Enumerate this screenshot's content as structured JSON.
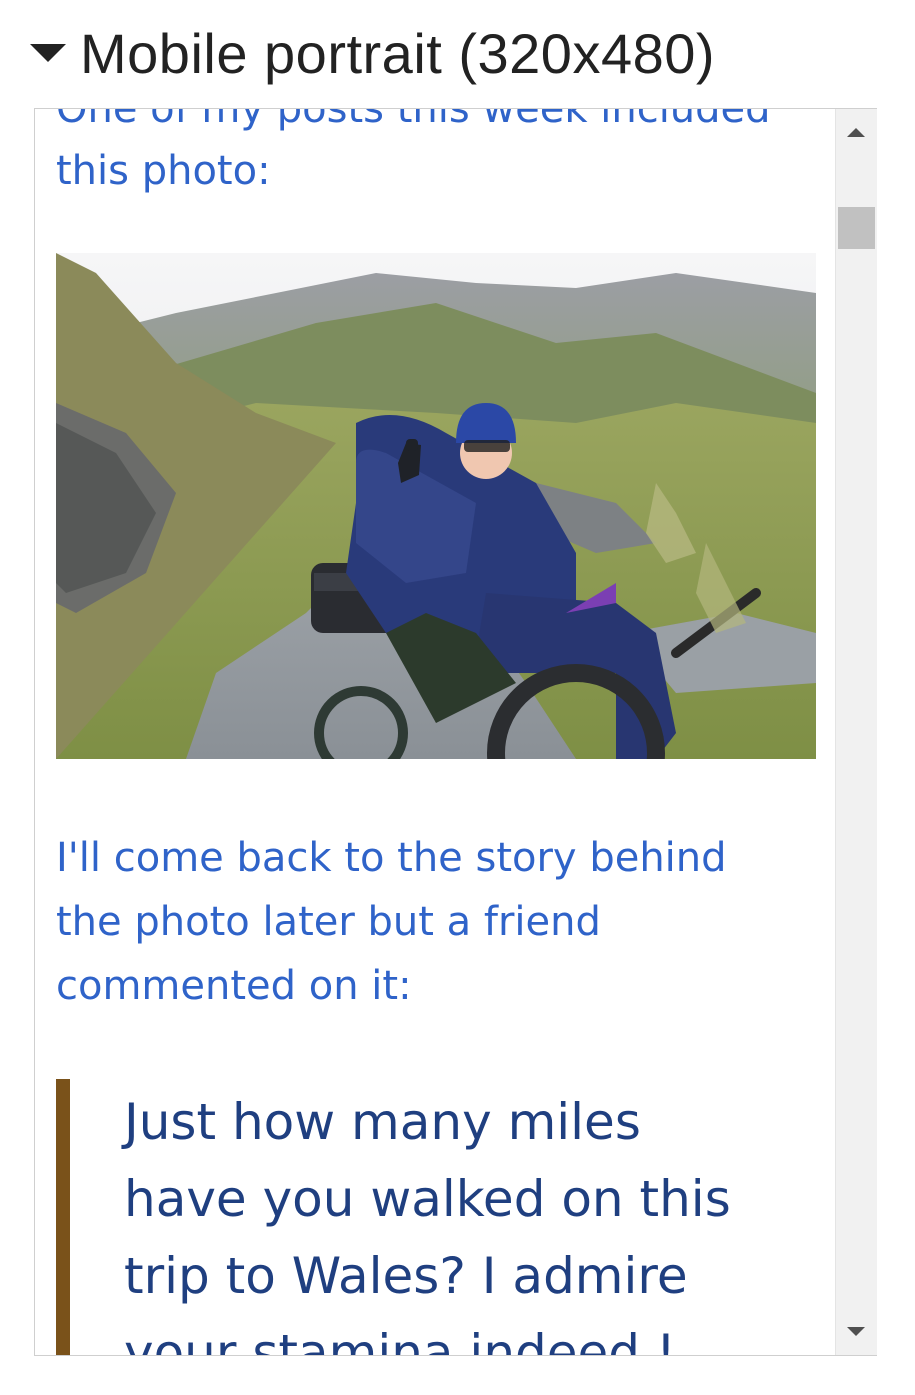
{
  "section": {
    "title": "Mobile portrait (320x480)",
    "expanded_icon": "caret-down-icon"
  },
  "article": {
    "cut_line": "One of my posts this week included",
    "intro_tail": "this photo:",
    "photo_icon": "photo-wheelchair-mountain-path",
    "story": "I'll come back to the story behind the photo later but a friend commented on it:",
    "quote": "Just how many miles have you walked on this trip to Wales? I admire your stamina indeed !"
  },
  "colors": {
    "link_text": "#2f63c9",
    "quote_text": "#1f3f80",
    "quote_bar": "#7a521a"
  },
  "scrollbar": {
    "up_icon": "scroll-up-arrow-icon",
    "down_icon": "scroll-down-arrow-icon"
  }
}
